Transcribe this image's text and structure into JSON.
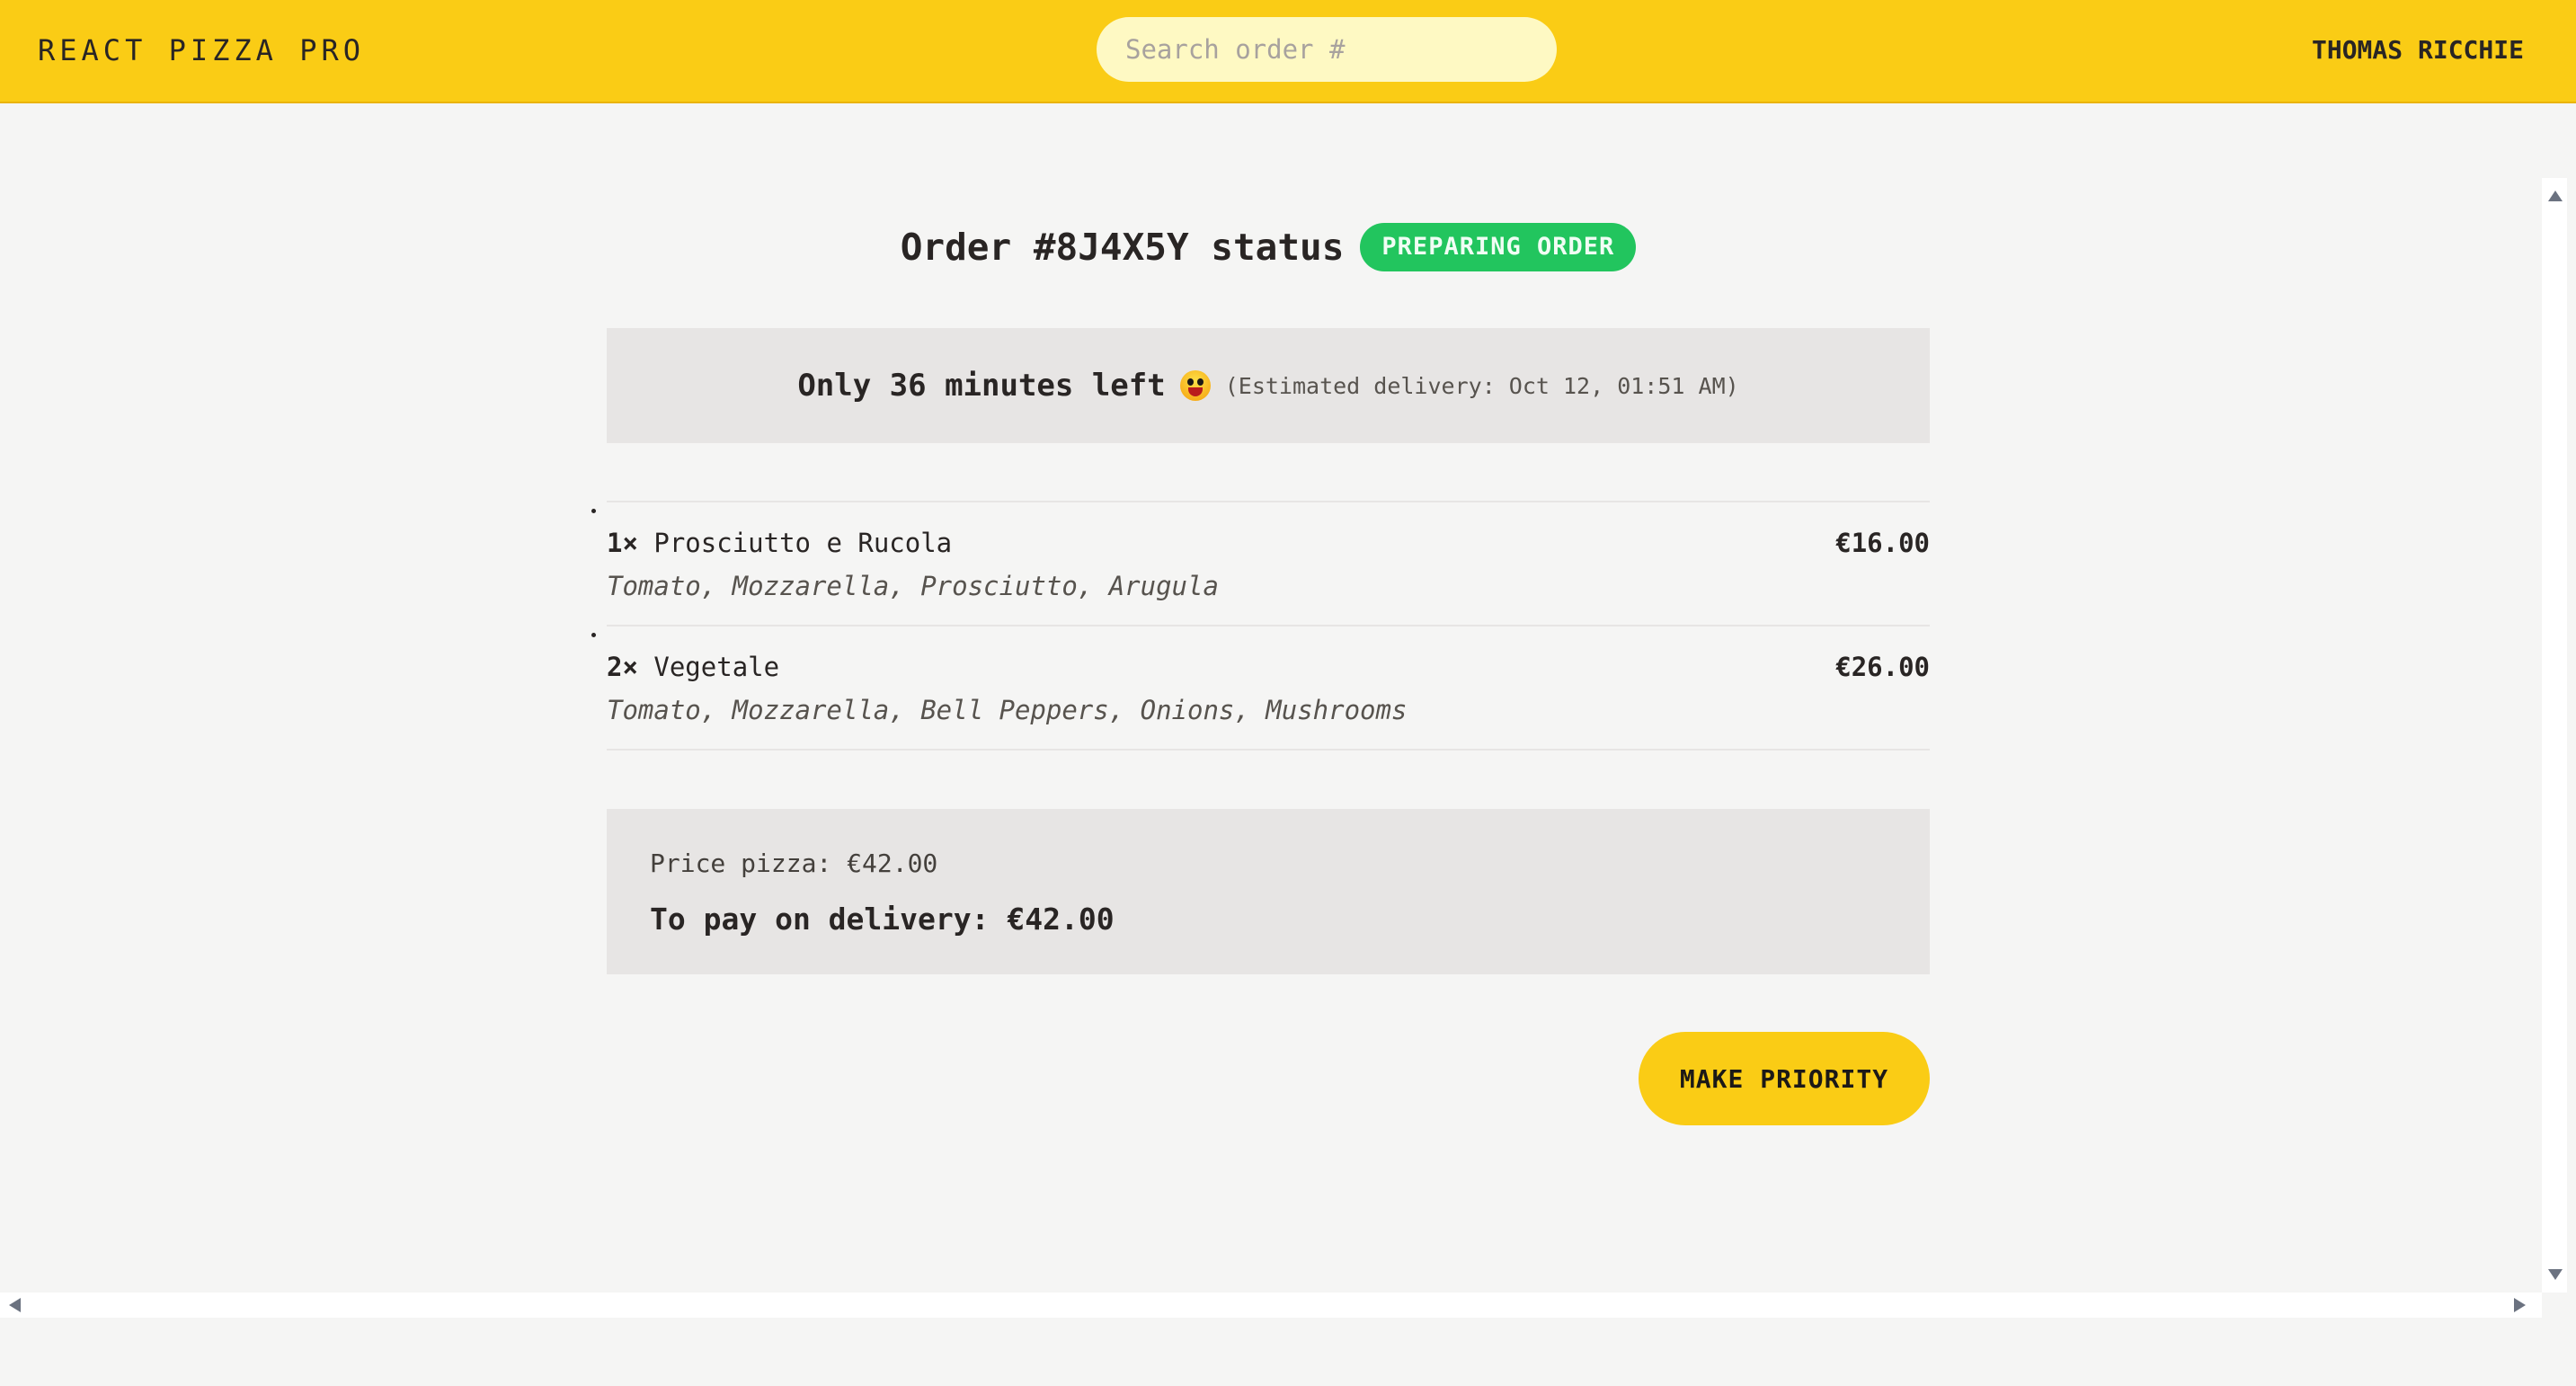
{
  "header": {
    "logo": "REACT PIZZA PRO",
    "search_placeholder": "Search order #",
    "username": "THOMAS RICCHIE"
  },
  "order": {
    "title": "Order #8J4X5Y status",
    "status": "PREPARING ORDER",
    "eta_main": "Only 36 minutes left",
    "eta_emoji": "grinning-face-icon",
    "eta_sub": "(Estimated delivery: Oct 12, 01:51 AM)"
  },
  "items": [
    {
      "qty": "1×",
      "name": "Prosciutto e Rucola",
      "price": "€16.00",
      "ingredients": "Tomato, Mozzarella, Prosciutto, Arugula"
    },
    {
      "qty": "2×",
      "name": "Vegetale",
      "price": "€26.00",
      "ingredients": "Tomato, Mozzarella, Bell Peppers, Onions, Mushrooms"
    }
  ],
  "totals": {
    "price_pizza": "Price pizza: €42.00",
    "to_pay": "To pay on delivery: €42.00"
  },
  "actions": {
    "make_priority": "MAKE PRIORITY"
  },
  "colors": {
    "header_bg": "#facc15",
    "status_badge": "#22c55e",
    "page_bg": "#f5f5f4",
    "panel_bg": "#e7e5e4"
  }
}
